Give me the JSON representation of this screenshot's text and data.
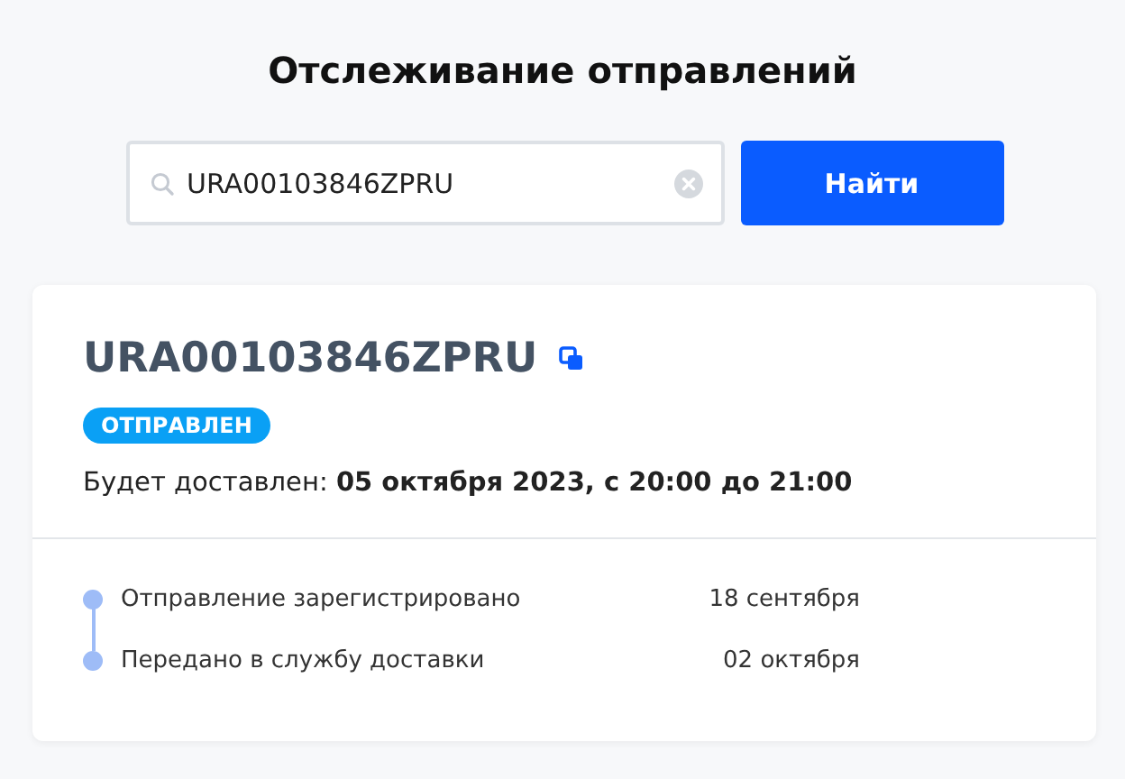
{
  "title": "Отслеживание отправлений",
  "search": {
    "value": "URA00103846ZPRU",
    "button": "Найти"
  },
  "shipment": {
    "number": "URA00103846ZPRU",
    "status": "ОТПРАВЛЕН",
    "delivery": "Будет доставлен: **05 октября 2023, с 20:00 до 21:00**",
    "events": [
      {
        "label": "Отправление зарегистрировано",
        "date": "18 сентября"
      },
      {
        "label": "Передано в службу доставки",
        "date": "02 октября"
      }
    ]
  }
}
